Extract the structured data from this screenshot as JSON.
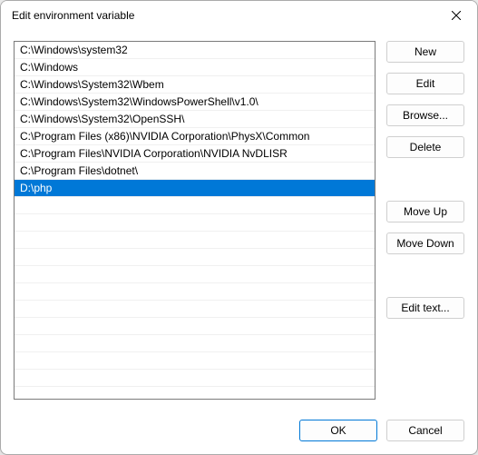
{
  "title": "Edit environment variable",
  "list": {
    "selected_index": 8,
    "items": [
      "C:\\Windows\\system32",
      "C:\\Windows",
      "C:\\Windows\\System32\\Wbem",
      "C:\\Windows\\System32\\WindowsPowerShell\\v1.0\\",
      "C:\\Windows\\System32\\OpenSSH\\",
      "C:\\Program Files (x86)\\NVIDIA Corporation\\PhysX\\Common",
      "C:\\Program Files\\NVIDIA Corporation\\NVIDIA NvDLISR",
      "C:\\Program Files\\dotnet\\",
      "D:\\php"
    ]
  },
  "buttons": {
    "new": "New",
    "edit": "Edit",
    "browse": "Browse...",
    "delete": "Delete",
    "move_up": "Move Up",
    "move_down": "Move Down",
    "edit_text": "Edit text...",
    "ok": "OK",
    "cancel": "Cancel"
  }
}
